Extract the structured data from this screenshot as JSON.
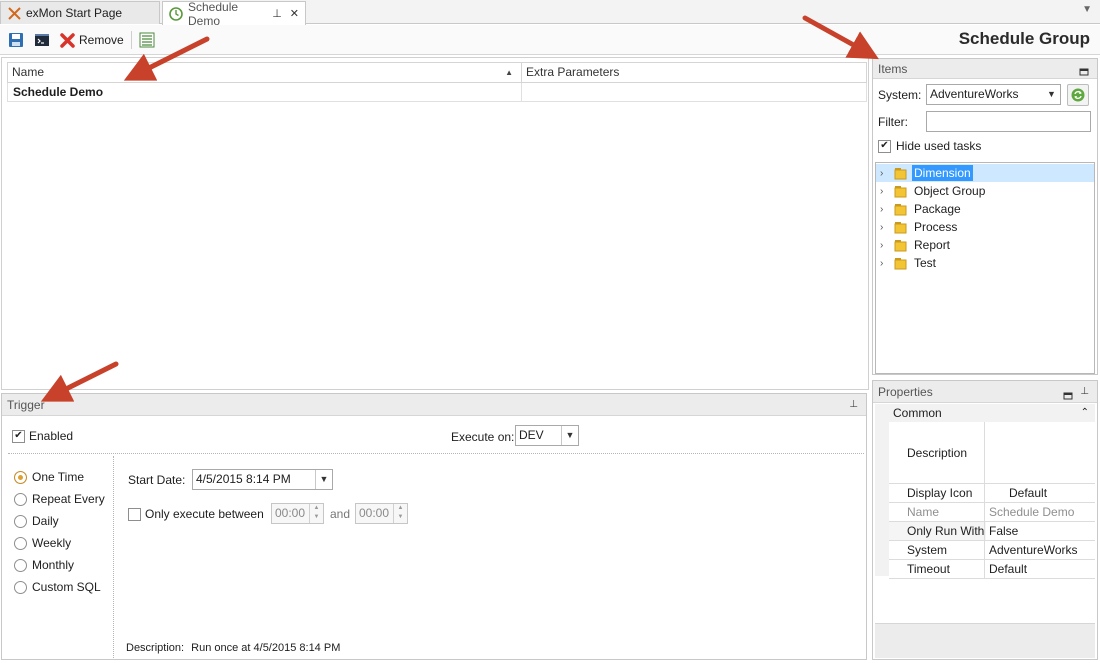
{
  "tabs": [
    {
      "label": "exMon Start Page",
      "icon": "exmon-logo-icon",
      "active": false
    },
    {
      "label": "Schedule Demo",
      "icon": "schedule-clock-icon",
      "active": true
    }
  ],
  "toolbar": {
    "save_icon": "save-icon",
    "console_icon": "console-icon",
    "remove_label": "Remove",
    "list_icon": "list-icon",
    "view_title": "Schedule Group"
  },
  "grid": {
    "columns": [
      "Name",
      "Extra Parameters"
    ],
    "sort_indicator": "▲",
    "rows": [
      {
        "name": "Schedule Demo",
        "extra_parameters": ""
      }
    ]
  },
  "items_panel": {
    "title": "Items",
    "system_label": "System:",
    "system_value": "AdventureWorks",
    "filter_label": "Filter:",
    "filter_value": "",
    "hide_used_label": "Hide used tasks",
    "hide_used_checked": true,
    "tree": [
      {
        "label": "Dimension",
        "selected": true
      },
      {
        "label": "Object Group",
        "selected": false
      },
      {
        "label": "Package",
        "selected": false
      },
      {
        "label": "Process",
        "selected": false
      },
      {
        "label": "Report",
        "selected": false
      },
      {
        "label": "Test",
        "selected": false
      }
    ]
  },
  "trigger_panel": {
    "title": "Trigger",
    "enabled_label": "Enabled",
    "enabled_checked": true,
    "execute_on_label": "Execute on:",
    "execute_on_value": "DEV",
    "modes": [
      {
        "label": "One Time",
        "selected": true
      },
      {
        "label": "Repeat Every",
        "selected": false
      },
      {
        "label": "Daily",
        "selected": false
      },
      {
        "label": "Weekly",
        "selected": false
      },
      {
        "label": "Monthly",
        "selected": false
      },
      {
        "label": "Custom SQL",
        "selected": false
      }
    ],
    "start_date_label": "Start Date:",
    "start_date_value": "4/5/2015 8:14 PM",
    "only_between_label": "Only execute between",
    "only_between_checked": false,
    "from_time": "00:00",
    "and_label": "and",
    "to_time": "00:00",
    "description_label": "Description:",
    "description_value": "Run once at 4/5/2015 8:14 PM"
  },
  "properties_panel": {
    "title": "Properties",
    "category": "Common",
    "rows": [
      {
        "name": "Description",
        "value": ""
      },
      {
        "name": "Display Icon",
        "value": "Default"
      },
      {
        "name": "Name",
        "value": "Schedule Demo"
      },
      {
        "name": "Only Run With I",
        "value": "False"
      },
      {
        "name": "System",
        "value": "AdventureWorks"
      },
      {
        "name": "Timeout",
        "value": "Default"
      }
    ]
  },
  "colors": {
    "annotation_arrow": "#c8412a",
    "selection": "#3399ff",
    "radio_selected": "#e0a030"
  }
}
